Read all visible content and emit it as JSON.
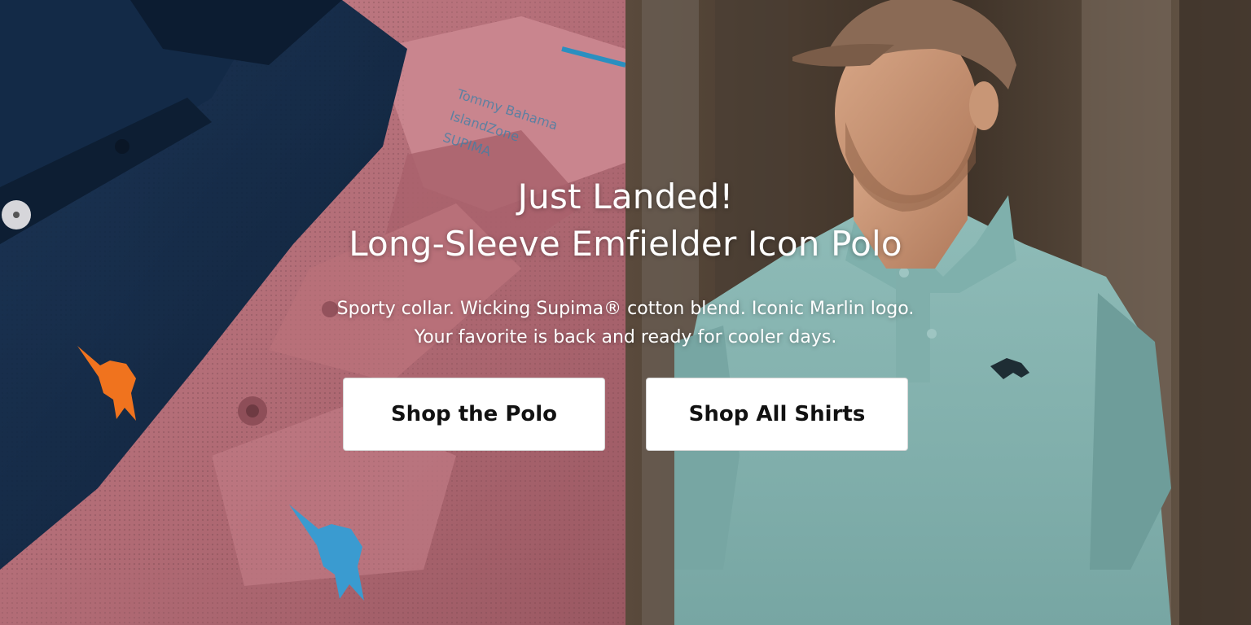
{
  "hero": {
    "eyebrow": "Just Landed!",
    "headline": "Long-Sleeve Emfielder Icon Polo",
    "subcopy_line1": "Sporty collar. Wicking Supima® cotton blend. Iconic Marlin logo.",
    "subcopy_line2": "Your favorite is back and ready for cooler days."
  },
  "buttons": {
    "shop_polo_label": "Shop the Polo",
    "shop_all_shirts_label": "Shop All Shirts"
  },
  "colors": {
    "navy_polo": "#152a45",
    "pink_polo": "#b8707a",
    "teal_polo": "#86b3b0",
    "cap": "#8a6a55",
    "marlin_orange": "#f0731e",
    "marlin_blue": "#3a9bd0",
    "button_bg": "#ffffff",
    "button_text": "#111111"
  },
  "imagery": {
    "left": "folded-polos-photo",
    "right": "man-in-polo-photo"
  }
}
